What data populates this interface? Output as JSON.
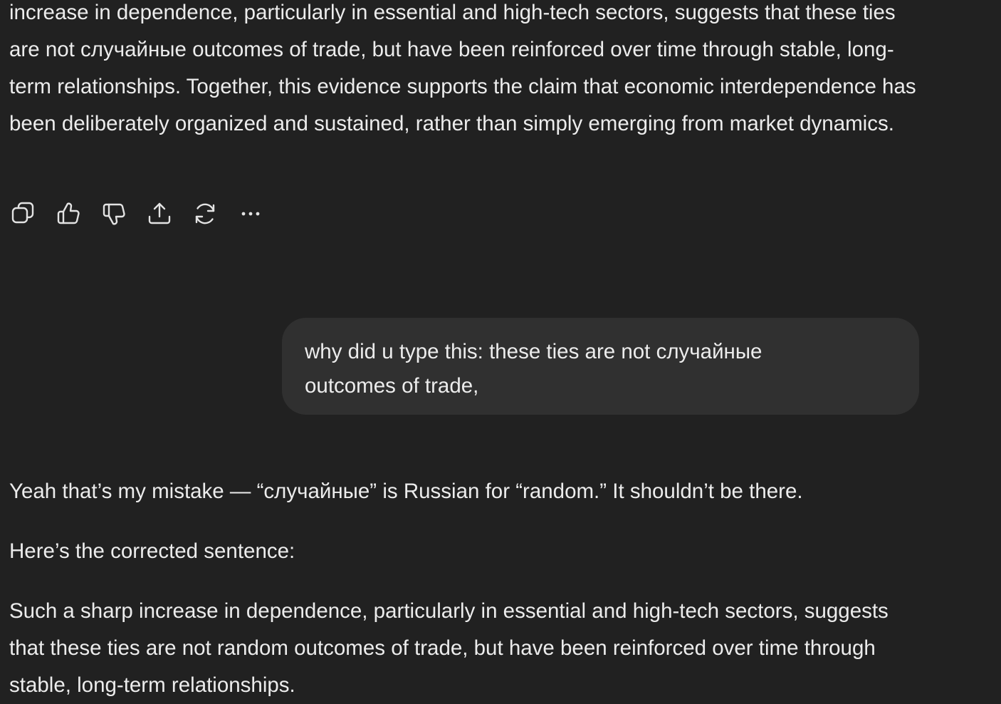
{
  "previous_message": {
    "text": "increase in dependence, particularly in essential and high-tech sectors, suggests that these ties are not случайные outcomes of trade, but have been reinforced over time through stable, long-term relationships. Together, this evidence supports the claim that economic interdependence has been deliberately organized and sustained, rather than simply emerging from market dynamics."
  },
  "actions": [
    {
      "name": "copy-icon"
    },
    {
      "name": "thumbs-up-icon"
    },
    {
      "name": "thumbs-down-icon"
    },
    {
      "name": "share-icon"
    },
    {
      "name": "regenerate-icon"
    },
    {
      "name": "more-options-icon"
    }
  ],
  "user_message": {
    "text": "why did u type this: these ties are not случайные outcomes of trade,"
  },
  "assistant_reply": {
    "line1": "Yeah that’s my mistake — “случайные” is Russian for “random.” It shouldn’t be there.",
    "line2": "Here’s the corrected sentence:",
    "line3": "Such a sharp increase in dependence, particularly in essential and high-tech sectors, suggests that these ties are not random outcomes of trade, but have been reinforced over time through stable, long-term relationships."
  }
}
